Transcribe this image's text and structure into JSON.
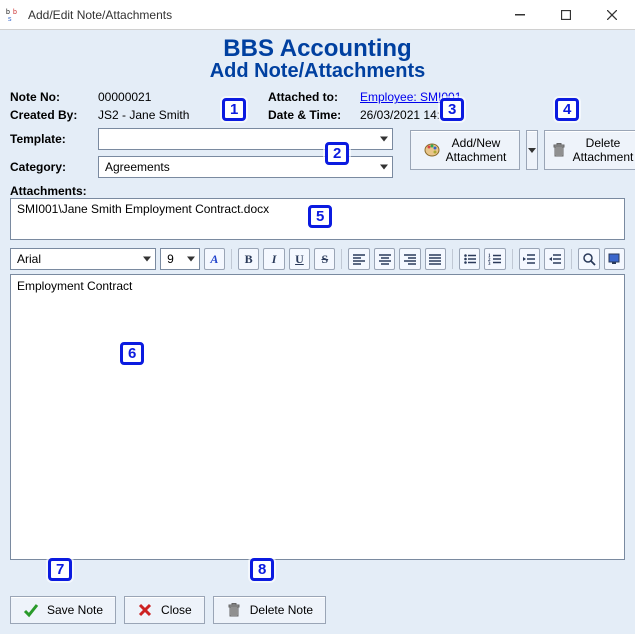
{
  "window": {
    "title": "Add/Edit Note/Attachments"
  },
  "heading": {
    "h1": "BBS Accounting",
    "h2": "Add Note/Attachments"
  },
  "labels": {
    "note_no": "Note No:",
    "created_by": "Created By:",
    "attached_to": "Attached to:",
    "date_time": "Date & Time:",
    "template": "Template:",
    "category": "Category:",
    "attachments": "Attachments:"
  },
  "values": {
    "note_no": "00000021",
    "created_by": "JS2 - Jane Smith",
    "attached_to": "Employee: SMI001",
    "date_time": "26/03/2021 14:20",
    "template": "",
    "category": "Agreements"
  },
  "attachments": {
    "items": [
      "SMI001\\Jane Smith Employment Contract.docx"
    ]
  },
  "buttons": {
    "add_new_line1": "Add/New",
    "add_new_line2": "Attachment",
    "delete_att_line1": "Delete",
    "delete_att_line2": "Attachment",
    "save_note": "Save Note",
    "close": "Close",
    "delete_note": "Delete Note"
  },
  "editor_toolbar": {
    "font": "Arial",
    "size": "9"
  },
  "editor": {
    "content": "Employment Contract"
  },
  "callouts": {
    "c1": "1",
    "c2": "2",
    "c3": "3",
    "c4": "4",
    "c5": "5",
    "c6": "6",
    "c7": "7",
    "c8": "8"
  }
}
